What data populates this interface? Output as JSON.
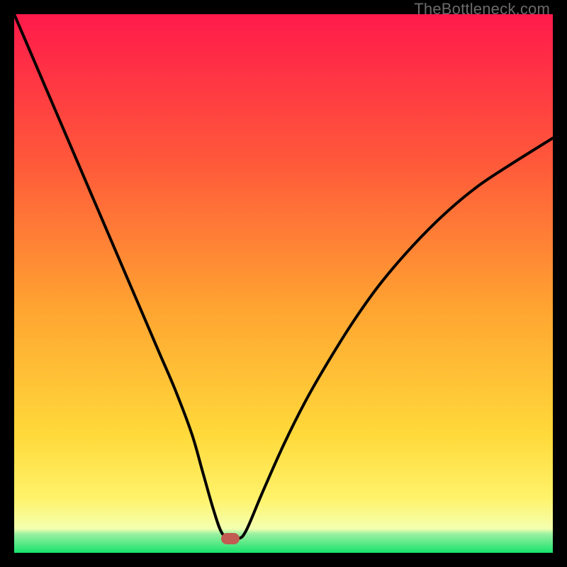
{
  "watermark": "TheBottleneck.com",
  "gradient_colors": {
    "c0": "#ff1a4b",
    "c1": "#ff5a3a",
    "c2": "#ffa531",
    "c3": "#ffd93a",
    "c4": "#fff36b",
    "c5": "#f4ffb0",
    "c6": "#9bf0a0",
    "c7": "#17e36b"
  },
  "marker": {
    "x_pct": 40.1,
    "y_pct": 97.4,
    "color": "#c25b52"
  },
  "curve_style": {
    "stroke": "#000000",
    "stroke_width": 4
  },
  "chart_data": {
    "type": "line",
    "title": "",
    "xlabel": "",
    "ylabel": "",
    "xlim": [
      0,
      100
    ],
    "ylim": [
      0,
      100
    ],
    "x": [
      0,
      3,
      6,
      9,
      12,
      15,
      18,
      21,
      24,
      27,
      30,
      33,
      35,
      37,
      38.5,
      40,
      41.5,
      43,
      46,
      50,
      54,
      58,
      63,
      68,
      74,
      80,
      86,
      92,
      100
    ],
    "values": [
      100,
      93,
      86,
      79,
      72,
      65,
      58,
      51,
      44,
      37,
      30,
      22,
      15,
      8,
      3.8,
      2.6,
      2.6,
      4,
      11,
      20,
      28,
      35,
      43,
      50,
      57,
      63,
      68,
      72,
      77
    ],
    "notes": "V-shaped bottleneck curve; minimum around x≈40.5, y≈2.6. Red marker indicates the optimal/minimum point."
  }
}
